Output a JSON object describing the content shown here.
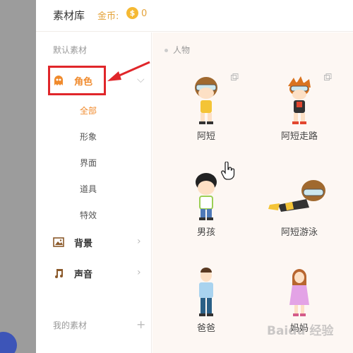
{
  "header": {
    "title": "素材库",
    "coin_label": "金币:",
    "coin_symbol": "$",
    "coin_count": "0"
  },
  "sidebar": {
    "default_section_label": "默认素材",
    "categories": [
      {
        "label": "角色",
        "icon": "ghost-icon"
      },
      {
        "label": "背景",
        "icon": "image-icon"
      },
      {
        "label": "声音",
        "icon": "music-note-icon"
      }
    ],
    "subitems": [
      "全部",
      "形象",
      "界面",
      "道具",
      "特效"
    ],
    "my_section_label": "我的素材"
  },
  "content": {
    "group_label": "人物",
    "items": [
      {
        "name": "阿短"
      },
      {
        "name": "阿短走路"
      },
      {
        "name": "男孩"
      },
      {
        "name": "阿短游泳"
      },
      {
        "name": "爸爸"
      },
      {
        "name": "妈妈"
      }
    ]
  },
  "watermark": "Baidu 经验",
  "colors": {
    "accent": "#f08a2c",
    "highlight_box": "#e0262a",
    "arrow": "#e0262a",
    "coin": "#f5b933"
  }
}
